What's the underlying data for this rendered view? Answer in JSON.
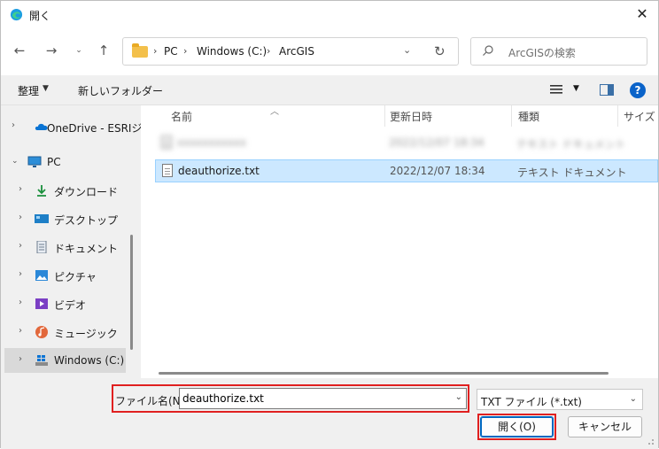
{
  "window": {
    "title": "開く"
  },
  "address": {
    "crumbs": [
      "PC",
      "Windows (C:)",
      "ArcGIS"
    ]
  },
  "search": {
    "placeholder": "ArcGISの検索"
  },
  "toolbar": {
    "organize": "整理",
    "new_folder": "新しいフォルダー"
  },
  "sidebar": {
    "items": [
      {
        "label": "OneDrive - ESRIジ",
        "icon": "cloud-icon"
      },
      {
        "label": "PC",
        "icon": "monitor-icon"
      },
      {
        "label": "ダウンロード",
        "icon": "download-icon"
      },
      {
        "label": "デスクトップ",
        "icon": "desktop-icon"
      },
      {
        "label": "ドキュメント",
        "icon": "document-icon"
      },
      {
        "label": "ピクチャ",
        "icon": "picture-icon"
      },
      {
        "label": "ビデオ",
        "icon": "video-icon"
      },
      {
        "label": "ミュージック",
        "icon": "music-icon"
      },
      {
        "label": "Windows (C:)",
        "icon": "drive-icon"
      }
    ]
  },
  "columns": {
    "name": "名前",
    "modified": "更新日時",
    "type": "種類",
    "size": "サイズ"
  },
  "files": [
    {
      "name": "xxxxxxxxxxx",
      "modified": "2022/12/07 18:34",
      "type": "テキスト ドキュメント",
      "blurred": true
    },
    {
      "name": "deauthorize.txt",
      "modified": "2022/12/07 18:34",
      "type": "テキスト ドキュメント",
      "selected": true
    }
  ],
  "footer": {
    "filename_label": "ファイル名(N):",
    "filename_value": "deauthorize.txt",
    "filetype": "TXT ファイル (*.txt)",
    "open_button": "開く(O)",
    "cancel_button": "キャンセル"
  },
  "colors": {
    "selection": "#cce8ff",
    "accent": "#0067c0",
    "highlight_box": "#e02020"
  }
}
